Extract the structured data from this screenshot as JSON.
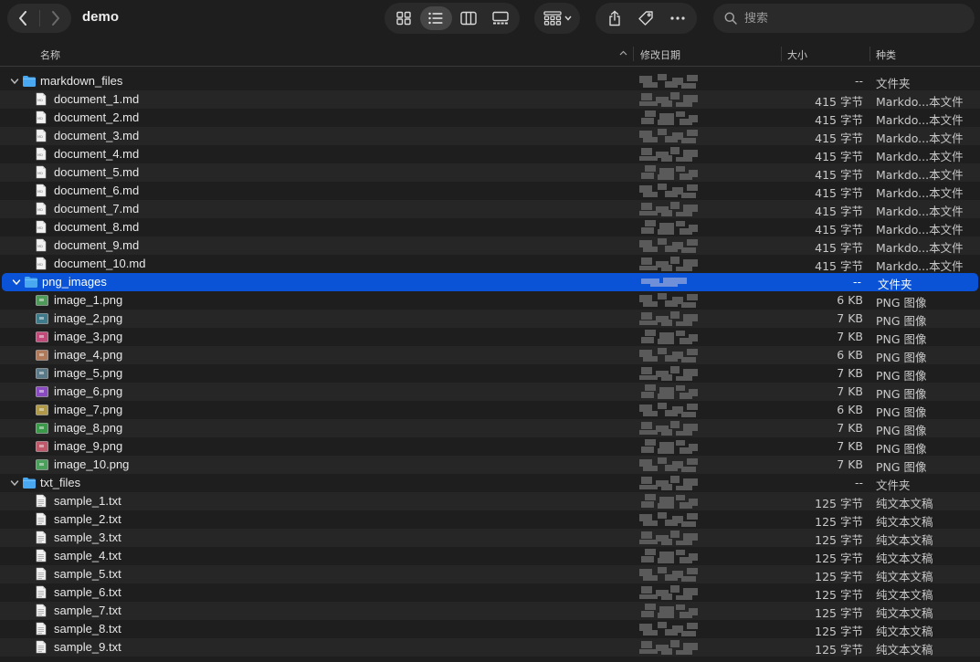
{
  "window": {
    "title": "demo"
  },
  "toolbar": {
    "back_icon": "chevron-left-icon",
    "forward_icon": "chevron-right-icon",
    "views": [
      "icon-view",
      "list-view",
      "column-view",
      "gallery-view"
    ],
    "active_view": "list-view",
    "search_placeholder": "搜索"
  },
  "columns": {
    "name": "名称",
    "date": "修改日期",
    "size": "大小",
    "kind": "种类"
  },
  "colors": {
    "selection": "#0a53d6",
    "folder": "#4aa8f0",
    "background": "#1e1e1e"
  },
  "rows": [
    {
      "type": "folder",
      "depth": 0,
      "expanded": true,
      "name": "markdown_files",
      "size": "--",
      "kind": "文件夹"
    },
    {
      "type": "md",
      "depth": 1,
      "name": "document_1.md",
      "size": "415 字节",
      "kind": "Markdo...本文件"
    },
    {
      "type": "md",
      "depth": 1,
      "name": "document_2.md",
      "size": "415 字节",
      "kind": "Markdo...本文件"
    },
    {
      "type": "md",
      "depth": 1,
      "name": "document_3.md",
      "size": "415 字节",
      "kind": "Markdo...本文件"
    },
    {
      "type": "md",
      "depth": 1,
      "name": "document_4.md",
      "size": "415 字节",
      "kind": "Markdo...本文件"
    },
    {
      "type": "md",
      "depth": 1,
      "name": "document_5.md",
      "size": "415 字节",
      "kind": "Markdo...本文件"
    },
    {
      "type": "md",
      "depth": 1,
      "name": "document_6.md",
      "size": "415 字节",
      "kind": "Markdo...本文件"
    },
    {
      "type": "md",
      "depth": 1,
      "name": "document_7.md",
      "size": "415 字节",
      "kind": "Markdo...本文件"
    },
    {
      "type": "md",
      "depth": 1,
      "name": "document_8.md",
      "size": "415 字节",
      "kind": "Markdo...本文件"
    },
    {
      "type": "md",
      "depth": 1,
      "name": "document_9.md",
      "size": "415 字节",
      "kind": "Markdo...本文件"
    },
    {
      "type": "md",
      "depth": 1,
      "name": "document_10.md",
      "size": "415 字节",
      "kind": "Markdo...本文件"
    },
    {
      "type": "folder",
      "depth": 0,
      "expanded": true,
      "selected": true,
      "name": "png_images",
      "size": "--",
      "kind": "文件夹"
    },
    {
      "type": "png",
      "depth": 1,
      "thumb": "#4f9a5a",
      "name": "image_1.png",
      "size": "6 KB",
      "kind": "PNG 图像"
    },
    {
      "type": "png",
      "depth": 1,
      "thumb": "#3e7a8a",
      "name": "image_2.png",
      "size": "7 KB",
      "kind": "PNG 图像"
    },
    {
      "type": "png",
      "depth": 1,
      "thumb": "#c04a7a",
      "name": "image_3.png",
      "size": "7 KB",
      "kind": "PNG 图像"
    },
    {
      "type": "png",
      "depth": 1,
      "thumb": "#b07a5a",
      "name": "image_4.png",
      "size": "6 KB",
      "kind": "PNG 图像"
    },
    {
      "type": "png",
      "depth": 1,
      "thumb": "#5a7a8a",
      "name": "image_5.png",
      "size": "7 KB",
      "kind": "PNG 图像"
    },
    {
      "type": "png",
      "depth": 1,
      "thumb": "#8a4ac0",
      "name": "image_6.png",
      "size": "7 KB",
      "kind": "PNG 图像"
    },
    {
      "type": "png",
      "depth": 1,
      "thumb": "#b09a4a",
      "name": "image_7.png",
      "size": "6 KB",
      "kind": "PNG 图像"
    },
    {
      "type": "png",
      "depth": 1,
      "thumb": "#3a9a4a",
      "name": "image_8.png",
      "size": "7 KB",
      "kind": "PNG 图像"
    },
    {
      "type": "png",
      "depth": 1,
      "thumb": "#c05a6a",
      "name": "image_9.png",
      "size": "7 KB",
      "kind": "PNG 图像"
    },
    {
      "type": "png",
      "depth": 1,
      "thumb": "#4aa05a",
      "name": "image_10.png",
      "size": "7 KB",
      "kind": "PNG 图像"
    },
    {
      "type": "folder",
      "depth": 0,
      "expanded": true,
      "name": "txt_files",
      "size": "--",
      "kind": "文件夹"
    },
    {
      "type": "txt",
      "depth": 1,
      "name": "sample_1.txt",
      "size": "125 字节",
      "kind": "纯文本文稿"
    },
    {
      "type": "txt",
      "depth": 1,
      "name": "sample_2.txt",
      "size": "125 字节",
      "kind": "纯文本文稿"
    },
    {
      "type": "txt",
      "depth": 1,
      "name": "sample_3.txt",
      "size": "125 字节",
      "kind": "纯文本文稿"
    },
    {
      "type": "txt",
      "depth": 1,
      "name": "sample_4.txt",
      "size": "125 字节",
      "kind": "纯文本文稿"
    },
    {
      "type": "txt",
      "depth": 1,
      "name": "sample_5.txt",
      "size": "125 字节",
      "kind": "纯文本文稿"
    },
    {
      "type": "txt",
      "depth": 1,
      "name": "sample_6.txt",
      "size": "125 字节",
      "kind": "纯文本文稿"
    },
    {
      "type": "txt",
      "depth": 1,
      "name": "sample_7.txt",
      "size": "125 字节",
      "kind": "纯文本文稿"
    },
    {
      "type": "txt",
      "depth": 1,
      "name": "sample_8.txt",
      "size": "125 字节",
      "kind": "纯文本文稿"
    },
    {
      "type": "txt",
      "depth": 1,
      "name": "sample_9.txt",
      "size": "125 字节",
      "kind": "纯文本文稿"
    }
  ]
}
